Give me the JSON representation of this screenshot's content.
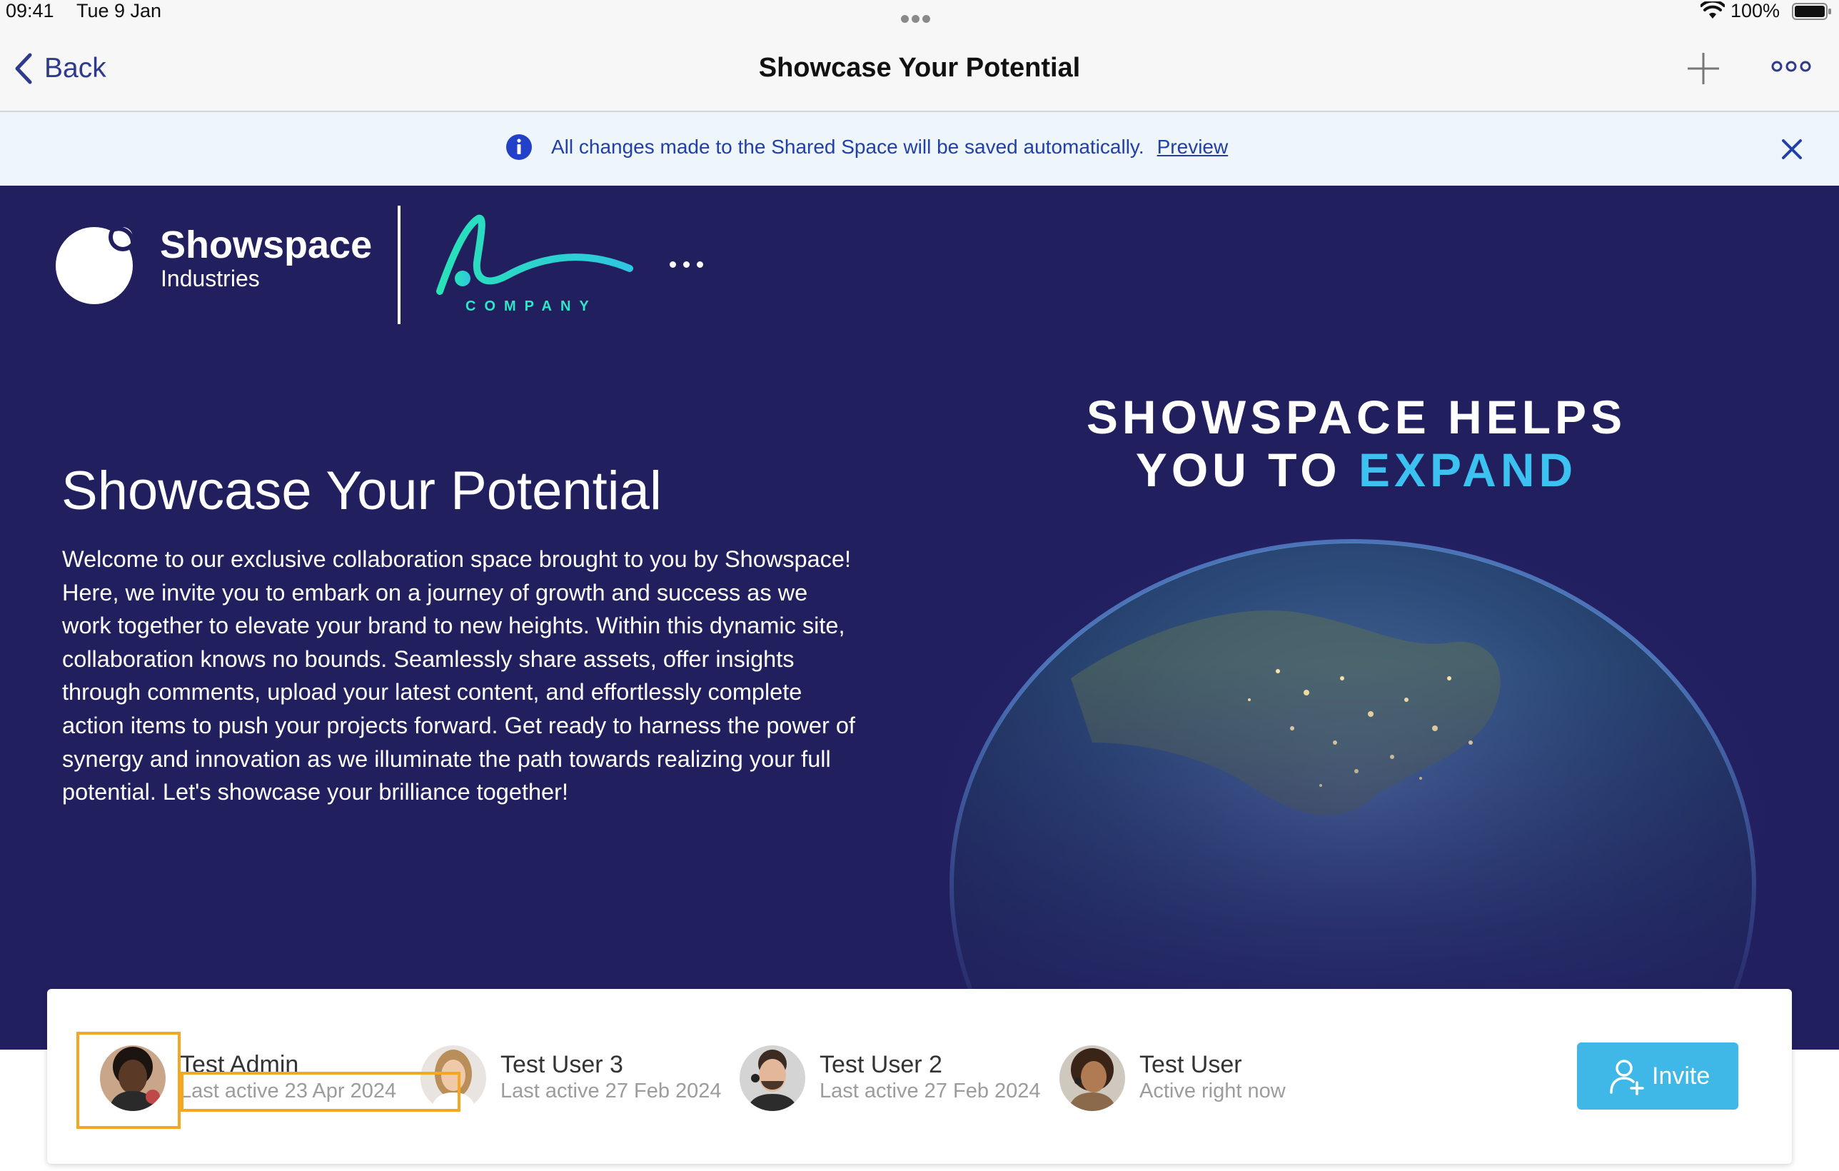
{
  "status_bar": {
    "time": "09:41",
    "date": "Tue 9 Jan",
    "battery": "100%",
    "icons": [
      "wifi-icon",
      "battery-icon"
    ]
  },
  "nav": {
    "back_label": "Back",
    "title": "Showcase Your Potential",
    "icons": [
      "plus-icon",
      "more-icon"
    ]
  },
  "banner": {
    "message": "All changes made to the Shared Space will be saved automatically.",
    "link": "Preview",
    "icons": [
      "info-icon",
      "close-icon"
    ]
  },
  "hero": {
    "brand_name": "Showspace",
    "brand_sub": "Industries",
    "company_label": "COMPANY",
    "title": "Showcase Your Potential",
    "body": "Welcome to our exclusive collaboration space brought to you by Showspace! Here, we invite you to embark on a journey of growth and success as we work together to elevate your brand to new heights. Within this dynamic site, collaboration knows no bounds. Seamlessly share assets, offer insights through comments, upload your latest content, and effortlessly complete action items to push your projects forward. Get ready to harness the power of synergy and innovation as we illuminate the path towards realizing your full potential. Let's showcase your brilliance together!",
    "promo_line1": "SHOWSPACE HELPS",
    "promo_line2_prefix": "YOU TO",
    "promo_line2_accent": "EXPAND",
    "accent_color": "#3cc2f0",
    "background_color": "#221f5f"
  },
  "members": [
    {
      "name": "Test Admin",
      "status": "Last active 23 Apr 2024"
    },
    {
      "name": "Test User 3",
      "status": "Last active 27 Feb 2024"
    },
    {
      "name": "Test User 2",
      "status": "Last active 27 Feb 2024"
    },
    {
      "name": "Test User",
      "status": "Active right now"
    }
  ],
  "invite": {
    "label": "Invite",
    "color": "#3fb8e8"
  },
  "highlight_color": "#f5a623"
}
